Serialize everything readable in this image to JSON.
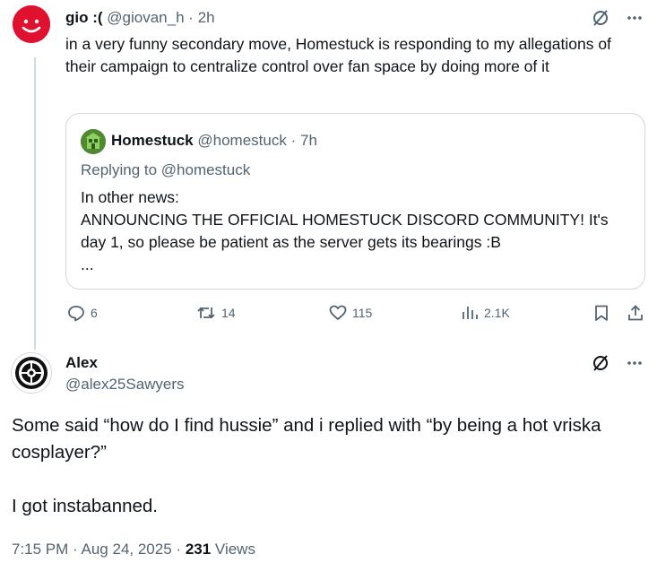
{
  "first_tweet": {
    "display_name": "gio :(",
    "handle": "@giovan_h",
    "separator": "·",
    "time": "2h",
    "text": "in a very funny secondary move, Homestuck is responding to my allegations of their campaign to centralize control over fan space by doing more of it",
    "avatar_icon": "red-smiley-avatar",
    "quote": {
      "display_name": "Homestuck",
      "handle": "@homestuck",
      "separator": "·",
      "time": "7h",
      "replying_to": "Replying to @homestuck",
      "text_line1": "In other news:",
      "text_line2": "ANNOUNCING THE OFFICIAL HOMESTUCK DISCORD COMMUNITY! It's day 1, so please be patient as the server gets its bearings :B",
      "text_ellipsis": "..."
    },
    "actions": {
      "replies": "6",
      "reposts": "14",
      "likes": "115",
      "views": "2.1K"
    }
  },
  "main_tweet": {
    "display_name": "Alex",
    "handle": "@alex25Sawyers",
    "paragraph1": "Some said “how do I find hussie” and i replied with “by being a hot vriska cosplayer?”",
    "paragraph2": "I got instabanned.",
    "time": "7:15 PM",
    "date": "Aug 24, 2025",
    "separator": "·",
    "views_count": "231",
    "views_label": "Views"
  },
  "colors": {
    "text": "#0f1419",
    "muted": "#536471",
    "border": "#cfd9de",
    "avatar_red": "#e0112f"
  }
}
